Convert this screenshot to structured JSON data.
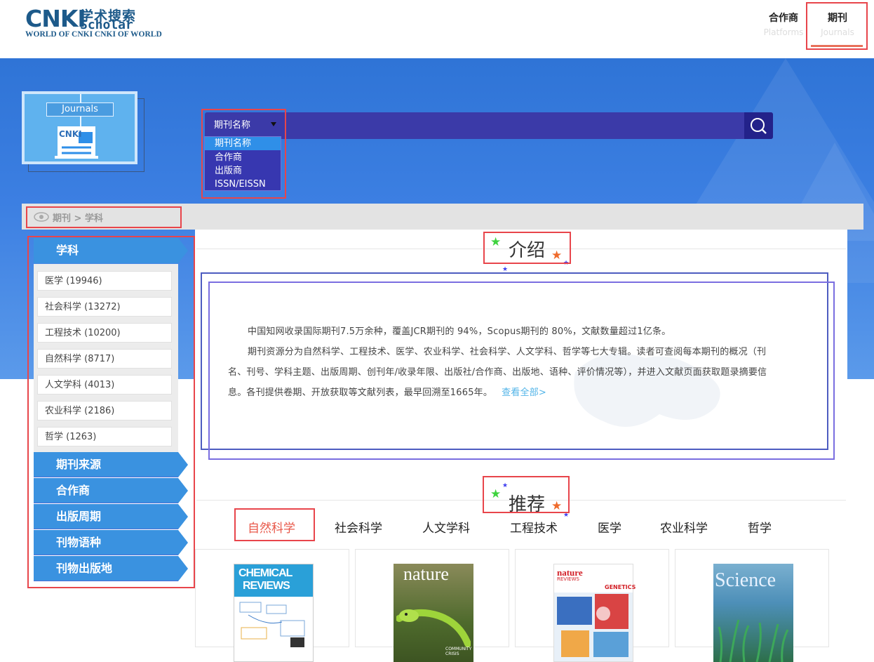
{
  "header": {
    "logo": {
      "brand": "CNKI",
      "cn_title": "学术搜索",
      "scholar": "Scholar",
      "subtitle": "WORLD OF CNKI CNKI OF WORLD"
    },
    "nav": [
      {
        "cn": "合作商",
        "en": "Platforms"
      },
      {
        "cn": "期刊",
        "en": "Journals"
      }
    ]
  },
  "banner": {
    "journal_tag": "Journals",
    "journal_building_label": "CNKI"
  },
  "search": {
    "selected": "期刊名称",
    "options": [
      "期刊名称",
      "合作商",
      "出版商",
      "ISSN/EISSN"
    ]
  },
  "breadcrumb": "期刊 > 学科",
  "intro": {
    "title": "介绍",
    "paragraph1": "中国知网收录国际期刊7.5万余种，覆盖JCR期刊的 94%，Scopus期刊的 80%，文献数量超过1亿条。",
    "paragraph2_line1": "期刊资源分为自然科学、工程技术、医学、农业科学、社会科学、人文学科、哲学等七大专辑。读者可查阅每本期刊的概况（刊",
    "paragraph2_line2": "名、刊号、学科主题、出版周期、创刊年/收录年限、出版社/合作商、出版地、语种、评价情况等），并进入文献页面获取题录摘要信",
    "paragraph2_line3": "息。各刊提供卷期、开放获取等文献列表，最早回溯至1665年。",
    "more_link": "查看全部>"
  },
  "sidebar": {
    "subject_header": "学科",
    "subjects": [
      "医学 (19946)",
      "社会科学 (13272)",
      "工程技术 (10200)",
      "自然科学 (8717)",
      "人文学科 (4013)",
      "农业科学 (2186)",
      "哲学 (1263)"
    ],
    "sections": [
      "期刊来源",
      "合作商",
      "出版周期",
      "刊物语种",
      "刊物出版地"
    ]
  },
  "recommend": {
    "title": "推荐",
    "tabs": [
      "自然科学",
      "社会科学",
      "人文学科",
      "工程技术",
      "医学",
      "农业科学",
      "哲学"
    ],
    "active_tab": 0,
    "covers": [
      {
        "title_line1": "CHEMICAL",
        "title_line2": "REVIEWS"
      },
      {
        "title_line1": "nature",
        "title_line2": "COMMUNITY CRISIS"
      },
      {
        "title_line1": "nature",
        "title_line2": "REVIEWS",
        "badge": "GENETICS"
      },
      {
        "title_line1": "Science",
        "title_line2": ""
      }
    ]
  },
  "colors": {
    "annotation_box": "#e8454b",
    "banner": "#3c7fe2",
    "sidebar_header": "#3a92e0",
    "active_tab": "#e8584a",
    "link": "#52b4e8"
  }
}
